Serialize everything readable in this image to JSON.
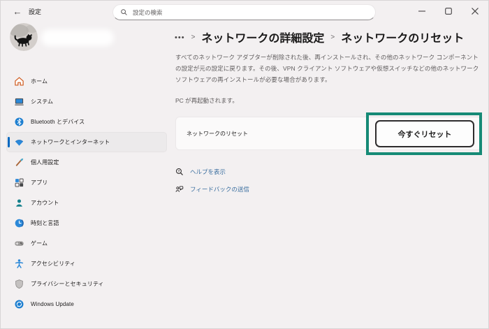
{
  "window": {
    "title": "設定"
  },
  "search": {
    "placeholder": "設定の検索"
  },
  "sidebar": {
    "items": [
      {
        "label": "ホーム"
      },
      {
        "label": "システム"
      },
      {
        "label": "Bluetooth とデバイス"
      },
      {
        "label": "ネットワークとインターネット",
        "selected": true
      },
      {
        "label": "個人用設定"
      },
      {
        "label": "アプリ"
      },
      {
        "label": "アカウント"
      },
      {
        "label": "時刻と言語"
      },
      {
        "label": "ゲーム"
      },
      {
        "label": "アクセシビリティ"
      },
      {
        "label": "プライバシーとセキュリティ"
      },
      {
        "label": "Windows Update"
      }
    ]
  },
  "breadcrumb": {
    "ellipsis": "•••",
    "separator": ">",
    "parent": "ネットワークの詳細設定",
    "current": "ネットワークのリセット"
  },
  "main": {
    "description": "すべてのネットワーク アダプターが削除された後、再インストールされ、その他のネットワーク コンポーネントの設定が元の設定に戻ります。その後、VPN クライアント ソフトウェアや仮想スイッチなどの他のネットワーク ソフトウェアの再インストールが必要な場合があります。",
    "restart_note": "PC が再起動されます。",
    "reset_row": {
      "label": "ネットワークのリセット",
      "button_label": "今すぐリセット"
    },
    "links": [
      {
        "label": "ヘルプを表示"
      },
      {
        "label": "フィードバックの送信"
      }
    ]
  },
  "colors": {
    "accent_blue": "#0067c0",
    "annotation_teal": "#168a76",
    "link_blue": "#3a6e9f",
    "background": "#f3f0f1"
  }
}
